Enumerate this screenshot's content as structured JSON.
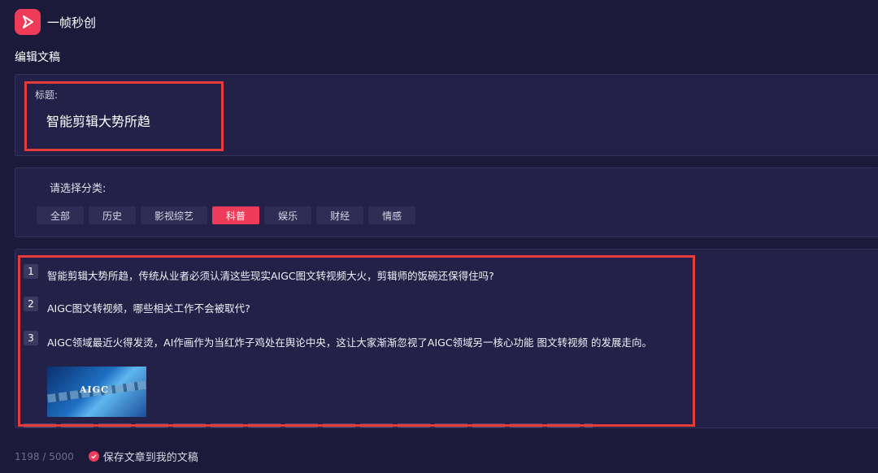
{
  "app": {
    "title": "一帧秒创"
  },
  "section": {
    "title": "编辑文稿"
  },
  "title_field": {
    "label": "标题:",
    "value": "智能剪辑大势所趋"
  },
  "category": {
    "label": "请选择分类:",
    "options": [
      "全部",
      "历史",
      "影视综艺",
      "科普",
      "娱乐",
      "财经",
      "情感"
    ],
    "selected": "科普"
  },
  "paragraphs": [
    {
      "num": "1",
      "text": "智能剪辑大势所趋，传统从业者必须认清这些现实AIGC图文转视频大火，剪辑师的饭碗还保得住吗?"
    },
    {
      "num": "2",
      "text": "AIGC图文转视频，哪些相关工作不会被取代?"
    },
    {
      "num": "3",
      "text": "AIGC领域最近火得发烫，AI作画作为当红炸子鸡处在舆论中央，这让大家渐渐忽视了AIGC领域另一核心功能 图文转视频 的发展走向。"
    }
  ],
  "image": {
    "caption": "AIGC"
  },
  "footer": {
    "count": "1198 / 5000",
    "save_label": "保存文章到我的文稿"
  },
  "colors": {
    "accent": "#ee3b5a",
    "background": "#1c1a3a",
    "panel": "#232147",
    "highlight": "#e63b3b"
  }
}
